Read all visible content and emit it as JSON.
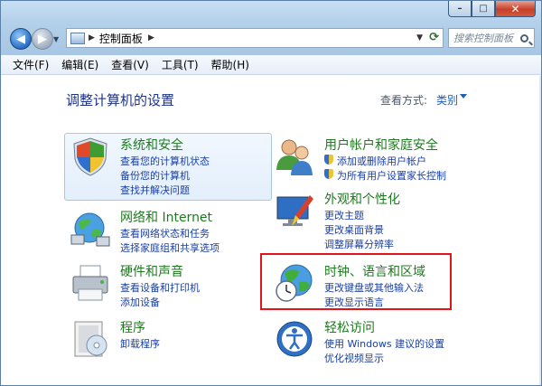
{
  "window": {
    "buttons": {
      "minimize": "–",
      "maximize": "□",
      "close": "✕"
    }
  },
  "address": {
    "path": "控制面板",
    "search_placeholder": "搜索控制面板"
  },
  "menu": [
    "文件(F)",
    "编辑(E)",
    "查看(V)",
    "工具(T)",
    "帮助(H)"
  ],
  "page": {
    "title": "调整计算机的设置",
    "view_by_label": "查看方式:",
    "view_by_value": "类别"
  },
  "categories": {
    "system": {
      "title": "系统和安全",
      "links": [
        "查看您的计算机状态",
        "备份您的计算机",
        "查找并解决问题"
      ]
    },
    "network": {
      "title": "网络和 Internet",
      "links": [
        "查看网络状态和任务",
        "选择家庭组和共享选项"
      ]
    },
    "hardware": {
      "title": "硬件和声音",
      "links": [
        "查看设备和打印机",
        "添加设备"
      ]
    },
    "programs": {
      "title": "程序",
      "links": [
        "卸载程序"
      ]
    },
    "users": {
      "title": "用户帐户和家庭安全",
      "links": [
        "添加或删除用户帐户",
        "为所有用户设置家长控制"
      ]
    },
    "appearance": {
      "title": "外观和个性化",
      "links": [
        "更改主题",
        "更改桌面背景",
        "调整屏幕分辨率"
      ]
    },
    "clock": {
      "title": "时钟、语言和区域",
      "links": [
        "更改键盘或其他输入法",
        "更改显示语言"
      ]
    },
    "access": {
      "title": "轻松访问",
      "links": [
        "使用 Windows 建议的设置",
        "优化视频显示"
      ]
    }
  },
  "colors": {
    "title_text": "#1e3287",
    "category_title": "#1e7a1e",
    "link": "#1a3fa3",
    "highlight_border": "#e0141a"
  }
}
